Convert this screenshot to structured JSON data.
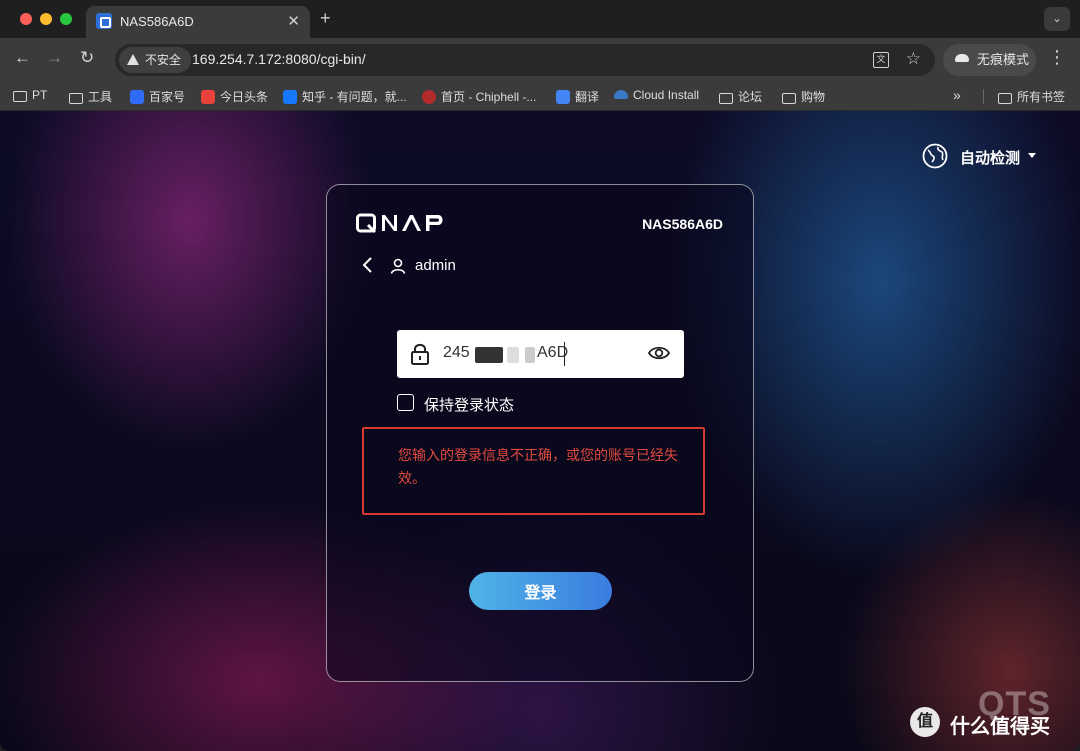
{
  "browser": {
    "tab": {
      "title": "NAS586A6D",
      "close": "✕"
    },
    "new_tab": "+",
    "tab_menu": "⌄",
    "nav": {
      "back": "←",
      "forward": "→",
      "reload": "↻"
    },
    "security_label": "不安全",
    "url": "169.254.7.172:8080/cgi-bin/",
    "translate_icon": "文",
    "star": "☆",
    "incognito_label": "无痕模式",
    "menu": "⋮",
    "bookmarks": [
      {
        "label": "PT",
        "icon": "folder-icon"
      },
      {
        "label": "工具",
        "icon": "folder-icon"
      },
      {
        "label": "百家号",
        "icon": "baijiahao-icon",
        "color": "#2e6cf6"
      },
      {
        "label": "今日头条",
        "icon": "toutiao-icon",
        "color": "#e8423a"
      },
      {
        "label": "知乎 - 有问题，就...",
        "icon": "zhihu-icon",
        "color": "#1677ff"
      },
      {
        "label": "首页 - Chiphell -...",
        "icon": "chiphell-icon",
        "color": "#b22b2b"
      },
      {
        "label": "翻译",
        "icon": "translate-icon",
        "color": "#4285f4"
      },
      {
        "label": "Cloud Install",
        "icon": "cloud-icon",
        "color": "#3a78c8"
      },
      {
        "label": "论坛",
        "icon": "folder-icon"
      },
      {
        "label": "购物",
        "icon": "folder-icon"
      }
    ],
    "bookmarks_more": "»",
    "all_bookmarks": "所有书签"
  },
  "page": {
    "language_label": "自动检测",
    "device_name": "NAS586A6D",
    "username": "admin",
    "password_visible_prefix": "245",
    "password_visible_suffix": "A6D",
    "remember_label": "保持登录状态",
    "error_message": "您输入的登录信息不正确，或您的账号已经失效。",
    "login_button": "登录",
    "accent_color": "#3b7ce0",
    "error_color": "#e24a3f"
  },
  "watermarks": {
    "qts": "QTS",
    "smzdm_badge": "值",
    "smzdm_text": "什么值得买"
  }
}
